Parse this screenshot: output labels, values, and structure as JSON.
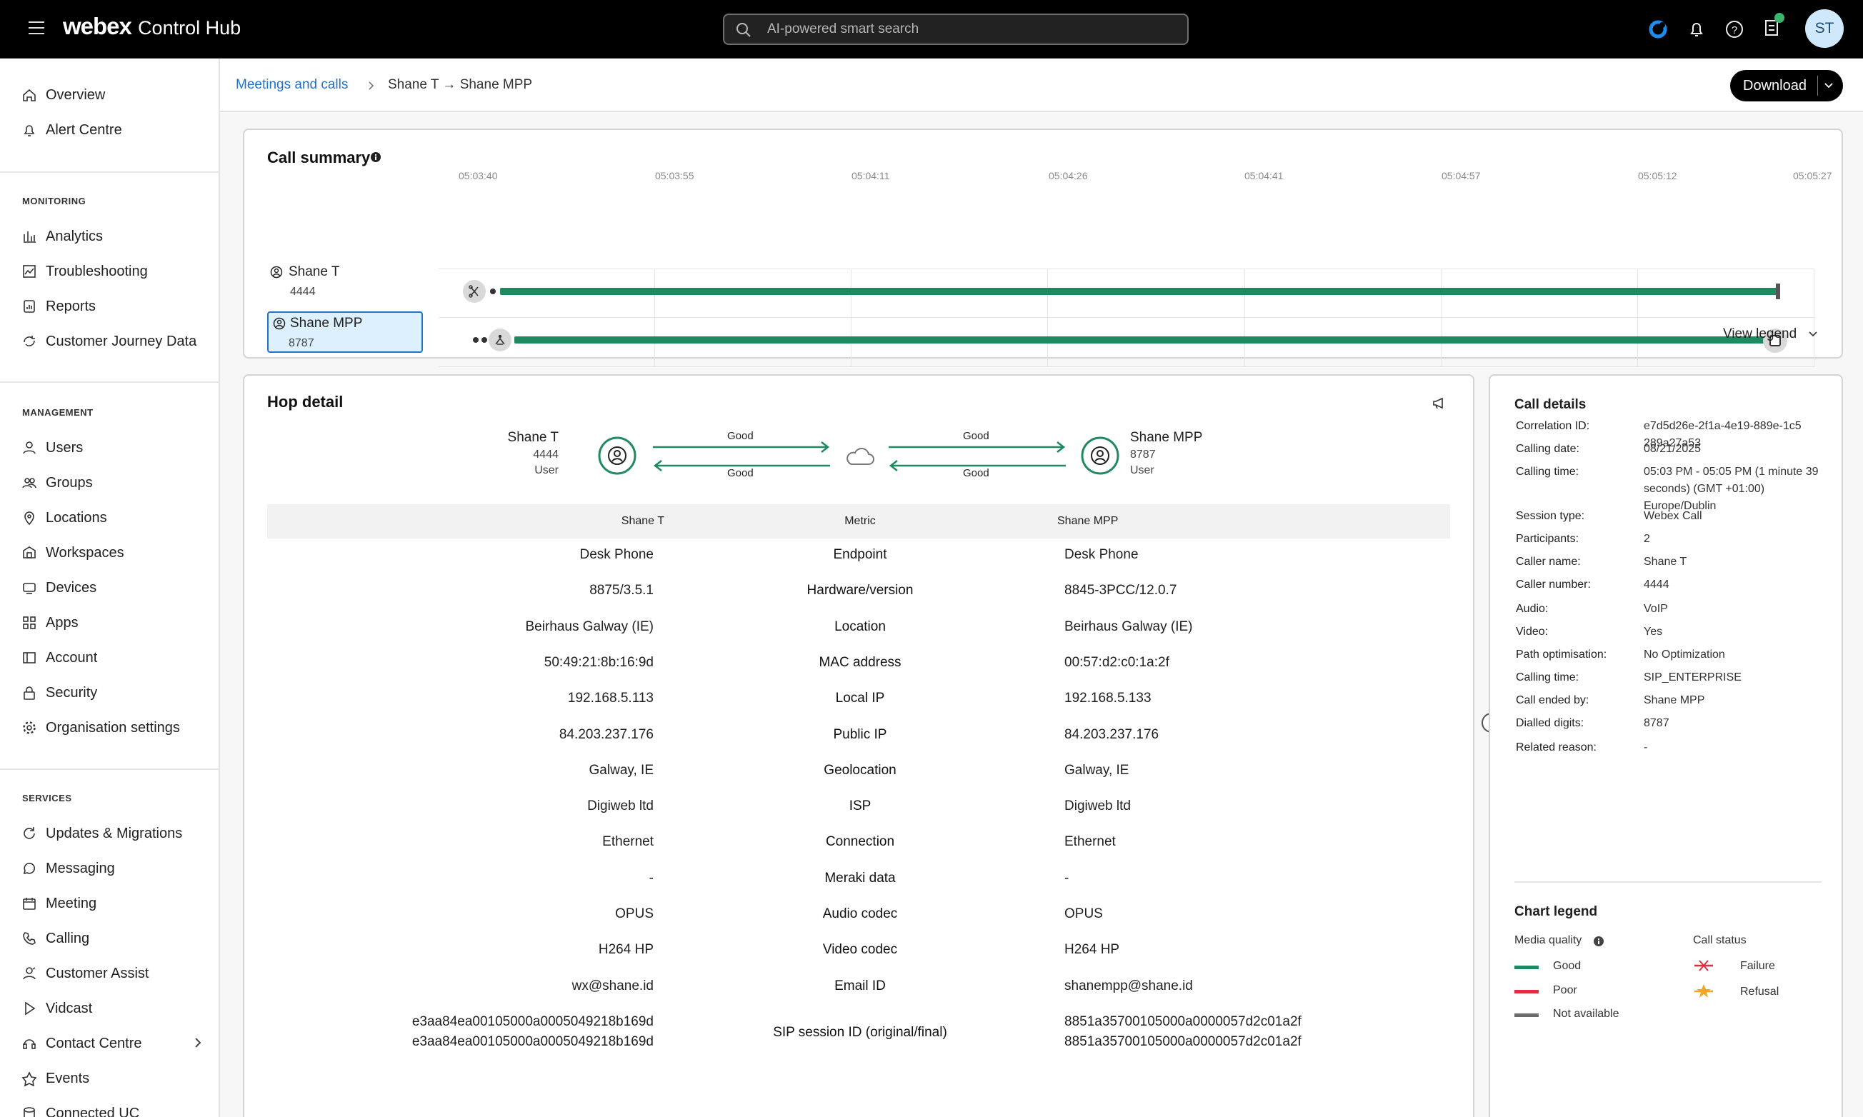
{
  "app": {
    "brand_bold": "webex",
    "brand_rest": "Control Hub",
    "search_placeholder": "AI-powered smart search",
    "avatar_initials": "ST"
  },
  "sidebar": {
    "top": [
      {
        "label": "Overview",
        "icon": "home-icon"
      },
      {
        "label": "Alert Centre",
        "icon": "bell-icon"
      }
    ],
    "monitoring_heading": "MONITORING",
    "monitoring": [
      {
        "label": "Analytics",
        "icon": "bar-chart-icon"
      },
      {
        "label": "Troubleshooting",
        "icon": "troubleshoot-icon"
      },
      {
        "label": "Reports",
        "icon": "report-icon"
      },
      {
        "label": "Customer Journey Data",
        "icon": "journey-icon"
      }
    ],
    "management_heading": "MANAGEMENT",
    "management": [
      {
        "label": "Users",
        "icon": "user-icon"
      },
      {
        "label": "Groups",
        "icon": "groups-icon"
      },
      {
        "label": "Locations",
        "icon": "location-pin-icon"
      },
      {
        "label": "Workspaces",
        "icon": "workspace-icon"
      },
      {
        "label": "Devices",
        "icon": "device-icon"
      },
      {
        "label": "Apps",
        "icon": "apps-icon"
      },
      {
        "label": "Account",
        "icon": "account-icon"
      },
      {
        "label": "Security",
        "icon": "lock-icon"
      },
      {
        "label": "Organisation settings",
        "icon": "gear-icon"
      }
    ],
    "services_heading": "SERVICES",
    "services": [
      {
        "label": "Updates & Migrations",
        "icon": "refresh-icon"
      },
      {
        "label": "Messaging",
        "icon": "chat-icon"
      },
      {
        "label": "Meeting",
        "icon": "calendar-icon"
      },
      {
        "label": "Calling",
        "icon": "phone-icon"
      },
      {
        "label": "Customer Assist",
        "icon": "assist-icon"
      },
      {
        "label": "Vidcast",
        "icon": "play-icon"
      },
      {
        "label": "Contact Centre",
        "icon": "contact-centre-icon"
      },
      {
        "label": "Events",
        "icon": "events-icon"
      },
      {
        "label": "Connected UC",
        "icon": "connected-uc-icon"
      }
    ]
  },
  "breadcrumb": {
    "parent": "Meetings and calls",
    "separator": ">",
    "current": "Shane T → Shane MPP"
  },
  "download_label": "Download",
  "call_summary": {
    "title": "Call summary",
    "ticks": [
      "05:03:40",
      "05:03:55",
      "05:04:11",
      "05:04:26",
      "05:04:41",
      "05:04:57",
      "05:05:12",
      "05:05:27"
    ],
    "participants": [
      {
        "name": "Shane T",
        "number": "4444",
        "quality": "Good"
      },
      {
        "name": "Shane MPP",
        "number": "8787",
        "quality": "Good"
      }
    ],
    "view_legend": "View legend"
  },
  "hop": {
    "title": "Hop detail",
    "left": {
      "name": "Shane T",
      "number": "4444",
      "role": "User"
    },
    "right": {
      "name": "Shane MPP",
      "number": "8787",
      "role": "User"
    },
    "links": [
      "Good",
      "Good",
      "Good",
      "Good"
    ],
    "headers": [
      "Shane T",
      "Metric",
      "Shane MPP"
    ],
    "rows": [
      {
        "l": "Desk Phone",
        "m": "Endpoint",
        "r": "Desk Phone"
      },
      {
        "l": "8875/3.5.1",
        "m": "Hardware/version",
        "r": "8845-3PCC/12.0.7"
      },
      {
        "l": "Beirhaus Galway (IE)",
        "m": "Location",
        "r": "Beirhaus Galway (IE)"
      },
      {
        "l": "50:49:21:8b:16:9d",
        "m": "MAC address",
        "r": "00:57:d2:c0:1a:2f"
      },
      {
        "l": "192.168.5.113",
        "m": "Local IP",
        "r": "192.168.5.133"
      },
      {
        "l": "84.203.237.176",
        "m": "Public IP",
        "r": "84.203.237.176"
      },
      {
        "l": "Galway, IE",
        "m": "Geolocation",
        "r": "Galway, IE"
      },
      {
        "l": "Digiweb ltd",
        "m": "ISP",
        "r": "Digiweb ltd"
      },
      {
        "l": "Ethernet",
        "m": "Connection",
        "r": "Ethernet"
      },
      {
        "l": "-",
        "m": "Meraki data",
        "r": "-"
      },
      {
        "l": "OPUS",
        "m": "Audio codec",
        "r": "OPUS"
      },
      {
        "l": "H264 HP",
        "m": "Video codec",
        "r": "H264 HP"
      },
      {
        "l": "wx@shane.id",
        "m": "Email ID",
        "r": "shanempp@shane.id"
      }
    ],
    "sip": {
      "m": "SIP session ID (original/final)",
      "l1": "e3aa84ea00105000a0005049218b169d",
      "l2": "e3aa84ea00105000a0005049218b169d",
      "r1": "8851a35700105000a0000057d2c01a2f",
      "r2": "8851a35700105000a0000057d2c01a2f"
    }
  },
  "call_details": {
    "title": "Call details",
    "items": [
      {
        "k": "Correlation ID:",
        "v": "e7d5d26e-2f1a-4e19-889e-1c5 289a27a53"
      },
      {
        "k": "Calling date:",
        "v": "08/21/2025"
      },
      {
        "k": "Calling time:",
        "v": "05:03 PM - 05:05 PM (1 minute 39 seconds) (GMT +01:00) Europe/Dublin"
      },
      {
        "k": "Session type:",
        "v": "Webex Call"
      },
      {
        "k": "Participants:",
        "v": "2"
      },
      {
        "k": "Caller name:",
        "v": "Shane T"
      },
      {
        "k": "Caller number:",
        "v": "4444"
      },
      {
        "k": "Audio:",
        "v": "VoIP"
      },
      {
        "k": "Video:",
        "v": "Yes"
      },
      {
        "k": "Path optimisation:",
        "v": "No Optimization"
      },
      {
        "k": "Calling time:",
        "v": "SIP_ENTERPRISE"
      },
      {
        "k": "Call ended by:",
        "v": "Shane MPP"
      },
      {
        "k": "Dialled digits:",
        "v": "8787"
      },
      {
        "k": "Related reason:",
        "v": "-"
      }
    ]
  },
  "legend": {
    "title": "Chart legend",
    "media_quality": "Media quality",
    "call_status": "Call status",
    "good": "Good",
    "poor": "Poor",
    "not_available": "Not available",
    "failure": "Failure",
    "refusal": "Refusal",
    "colors": {
      "good": "#1d8a5f",
      "poor": "#e02e3c",
      "not_available": "#6b6b6b",
      "failure": "#e02e3c",
      "refusal": "#f2a623"
    }
  }
}
